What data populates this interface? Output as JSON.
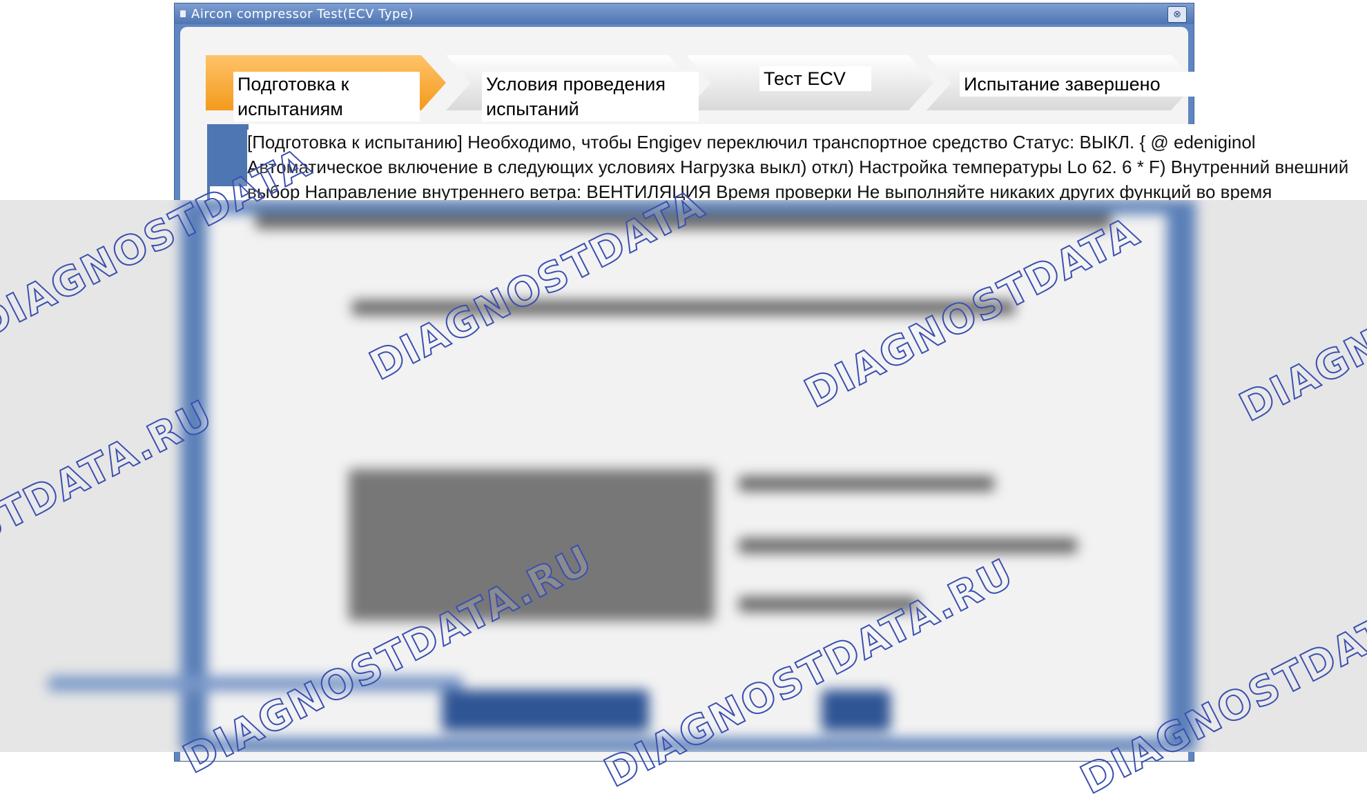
{
  "window": {
    "title": "Aircon compressor Test(ECV Type)",
    "close_glyph": "⊗"
  },
  "steps": [
    {
      "label": "Подготовка к испытаниям",
      "state": "active"
    },
    {
      "label": "Условия проведения испытаний",
      "state": "inactive"
    },
    {
      "label": "Тест ECV",
      "state": "inactive"
    },
    {
      "label": "Испытание завершено",
      "state": "inactive"
    }
  ],
  "info": {
    "text": "[Подготовка к испытанию] Необходимо, чтобы Engigev переключил транспортное средство Статус: ВЫКЛ. { @ edeniginol Автоматическое включение в следующих условиях Нагрузка выкл) откл) Настройка температуры Lo 62. 6 * F) Внутренний внешний выбор Направление внутреннего ветра: ВЕНТИЛЯЦИЯ Время проверки Не выполняйте никаких других функций во время проведения испытания: Во время испытания ECV: если"
  },
  "watermark": {
    "text_short": "DIAGNOSTDATA",
    "text_full": "DIAGNOSTDATA.RU",
    "color": "#3a4fb0"
  },
  "colors": {
    "frame_blue": "#5f86c1",
    "active_step": "#f39a1c",
    "inactive_step": "#d9d9d9"
  }
}
